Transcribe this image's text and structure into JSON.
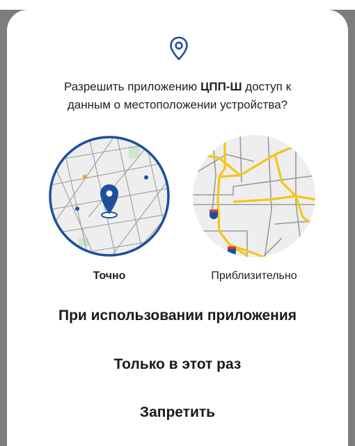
{
  "background_partial_text": "   ",
  "dialog": {
    "icon": "location-pin-icon",
    "question_prefix": "Разрешить приложению ",
    "app_name": "ЦПП-Ш",
    "question_suffix": " доступ к данным о местоположении устройства?",
    "options": [
      {
        "label": "Точно",
        "selected": true
      },
      {
        "label": "Приблизительно",
        "selected": false
      }
    ],
    "actions": [
      "При использовании приложения",
      "Только в этот раз",
      "Запретить"
    ],
    "colors": {
      "accent": "#1d4f9e",
      "map_bg": "#eeeeee",
      "road": "#f5c518",
      "scrim": "#7d7d7d"
    }
  }
}
